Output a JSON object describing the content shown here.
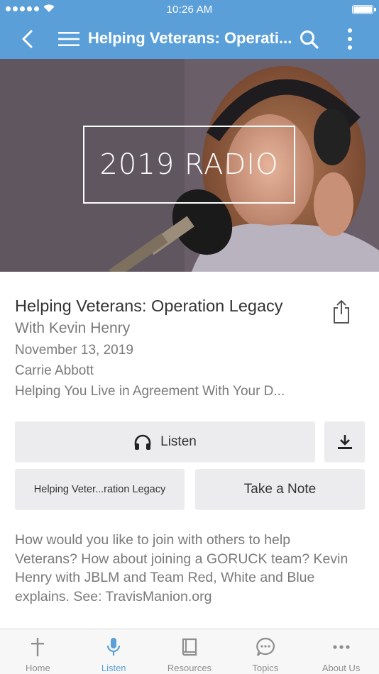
{
  "status_bar": {
    "time": "10:26 AM"
  },
  "nav": {
    "title": "Helping Veterans: Operati...",
    "icons": [
      "back-chevron-icon",
      "hamburger-menu-icon",
      "search-icon",
      "more-vertical-icon"
    ]
  },
  "hero": {
    "badge_text": "2019 RADIO"
  },
  "episode": {
    "title": "Helping Veterans: Operation Legacy",
    "subtitle": "With Kevin Henry",
    "date": "November 13, 2019",
    "speaker": "Carrie Abbott",
    "series": "Helping You Live in Agreement With Your D..."
  },
  "actions": {
    "listen_label": "Listen",
    "series_label": "Helping Veter...ration Legacy",
    "note_label": "Take a Note"
  },
  "description": "How would you like to join with others to help Veterans? How about joining a GORUCK team? Kevin Henry with JBLM and Team Red, White and Blue explains. See: TravisManion.org",
  "tab_bar": {
    "active": "Listen",
    "tabs": [
      {
        "label": "Home",
        "icon": "cross-icon"
      },
      {
        "label": "Listen",
        "icon": "microphone-icon"
      },
      {
        "label": "Resources",
        "icon": "book-icon"
      },
      {
        "label": "Topics",
        "icon": "chat-bubble-icon"
      },
      {
        "label": "About Us",
        "icon": "more-horizontal-icon"
      }
    ]
  },
  "colors": {
    "accent": "#5b9fd9",
    "button_bg": "#ececee",
    "muted_text": "#7a7a7a"
  }
}
